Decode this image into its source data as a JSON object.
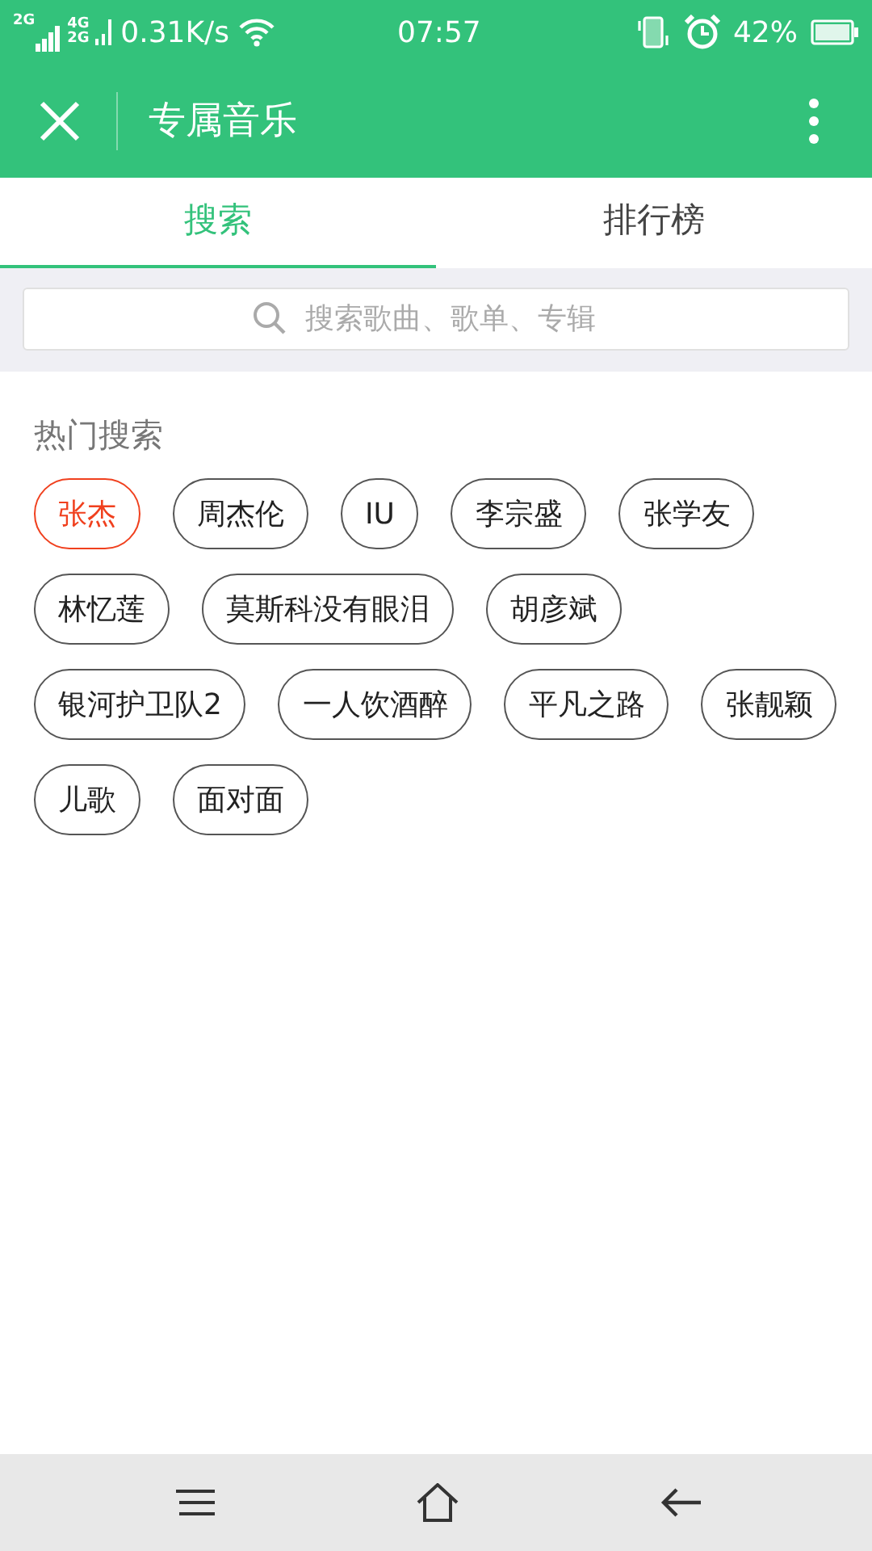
{
  "status_bar": {
    "network": "2G",
    "network_2": "4G 2G",
    "speed": "0.31K/s",
    "time": "07:57",
    "battery": "42%"
  },
  "header": {
    "title": "专属音乐"
  },
  "tabs": [
    {
      "label": "搜索",
      "selected": true
    },
    {
      "label": "排行榜",
      "selected": false
    }
  ],
  "search": {
    "placeholder": "搜索歌曲、歌单、专辑"
  },
  "hot_search": {
    "title": "热门搜索",
    "tags": [
      {
        "label": "张杰",
        "selected": true
      },
      {
        "label": "周杰伦",
        "selected": false
      },
      {
        "label": "IU",
        "selected": false
      },
      {
        "label": "李宗盛",
        "selected": false
      },
      {
        "label": "张学友",
        "selected": false
      },
      {
        "label": "林忆莲",
        "selected": false
      },
      {
        "label": "莫斯科没有眼泪",
        "selected": false
      },
      {
        "label": "胡彦斌",
        "selected": false
      },
      {
        "label": "银河护卫队2",
        "selected": false
      },
      {
        "label": "一人饮酒醉",
        "selected": false
      },
      {
        "label": "平凡之路",
        "selected": false
      },
      {
        "label": "张靓颖",
        "selected": false
      },
      {
        "label": "儿歌",
        "selected": false
      },
      {
        "label": "面对面",
        "selected": false
      }
    ]
  }
}
